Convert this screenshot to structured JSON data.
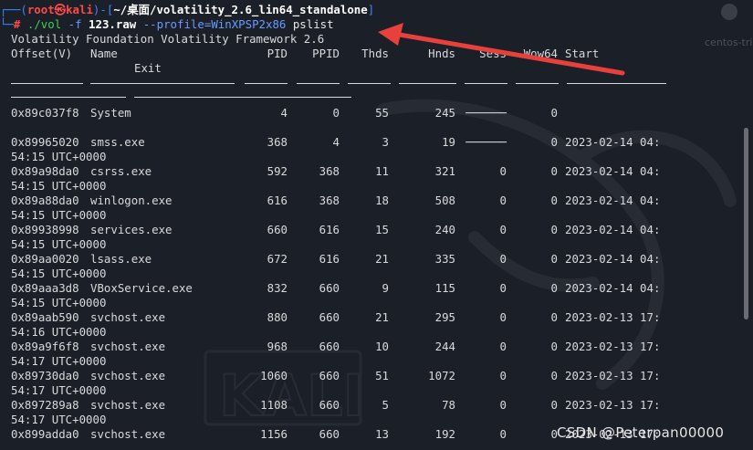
{
  "prompt": {
    "user": "root㉿kali",
    "path": "~/桌面/volatility_2.6_lin64_standalone",
    "hash": "#",
    "cmd": "./vol",
    "file_flag": "-f",
    "file": "123.raw",
    "profile_flag": "--profile=WinXPSP2x86",
    "plugin": "pslist"
  },
  "banner": "Volatility Foundation Volatility Framework 2.6",
  "headers": [
    "Offset(V)",
    "Name",
    "PID",
    "PPID",
    "Thds",
    "Hnds",
    "Sess",
    "Wow64",
    "Start",
    "Exit"
  ],
  "rows": [
    {
      "offset": "0x89c037f8",
      "name": "System",
      "pid": "4",
      "ppid": "0",
      "thds": "55",
      "hnds": "245",
      "sess": "──────",
      "wow": "0",
      "start": "",
      "cont": ""
    },
    {
      "offset": "0x89965020",
      "name": "smss.exe",
      "pid": "368",
      "ppid": "4",
      "thds": "3",
      "hnds": "19",
      "sess": "──────",
      "wow": "0",
      "start": "2023-02-14 04:",
      "cont": "54:15 UTC+0000"
    },
    {
      "offset": "0x89a98da0",
      "name": "csrss.exe",
      "pid": "592",
      "ppid": "368",
      "thds": "11",
      "hnds": "321",
      "sess": "0",
      "wow": "0",
      "start": "2023-02-14 04:",
      "cont": "54:15 UTC+0000"
    },
    {
      "offset": "0x89a88da0",
      "name": "winlogon.exe",
      "pid": "616",
      "ppid": "368",
      "thds": "18",
      "hnds": "508",
      "sess": "0",
      "wow": "0",
      "start": "2023-02-14 04:",
      "cont": "54:15 UTC+0000"
    },
    {
      "offset": "0x89938998",
      "name": "services.exe",
      "pid": "660",
      "ppid": "616",
      "thds": "15",
      "hnds": "240",
      "sess": "0",
      "wow": "0",
      "start": "2023-02-14 04:",
      "cont": "54:15 UTC+0000"
    },
    {
      "offset": "0x89aa0020",
      "name": "lsass.exe",
      "pid": "672",
      "ppid": "616",
      "thds": "21",
      "hnds": "335",
      "sess": "0",
      "wow": "0",
      "start": "2023-02-14 04:",
      "cont": "54:15 UTC+0000"
    },
    {
      "offset": "0x89aaa3d8",
      "name": "VBoxService.exe",
      "pid": "832",
      "ppid": "660",
      "thds": "9",
      "hnds": "115",
      "sess": "0",
      "wow": "0",
      "start": "2023-02-14 04:",
      "cont": "54:15 UTC+0000"
    },
    {
      "offset": "0x89aab590",
      "name": "svchost.exe",
      "pid": "880",
      "ppid": "660",
      "thds": "21",
      "hnds": "295",
      "sess": "0",
      "wow": "0",
      "start": "2023-02-13 17:",
      "cont": "54:16 UTC+0000"
    },
    {
      "offset": "0x89a9f6f8",
      "name": "svchost.exe",
      "pid": "968",
      "ppid": "660",
      "thds": "10",
      "hnds": "244",
      "sess": "0",
      "wow": "0",
      "start": "2023-02-13 17:",
      "cont": "54:17 UTC+0000"
    },
    {
      "offset": "0x89730da0",
      "name": "svchost.exe",
      "pid": "1060",
      "ppid": "660",
      "thds": "51",
      "hnds": "1072",
      "sess": "0",
      "wow": "0",
      "start": "2023-02-13 17:",
      "cont": "54:17 UTC+0000"
    },
    {
      "offset": "0x897289a8",
      "name": "svchost.exe",
      "pid": "1108",
      "ppid": "660",
      "thds": "5",
      "hnds": "78",
      "sess": "0",
      "wow": "0",
      "start": "2023-02-13 17:",
      "cont": "54:17 UTC+0000"
    },
    {
      "offset": "0x899adda0",
      "name": "svchost.exe",
      "pid": "1156",
      "ppid": "660",
      "thds": "13",
      "hnds": "192",
      "sess": "0",
      "wow": "0",
      "start": "2023-02-13 17:",
      "cont": ""
    }
  ],
  "watermark": "CSDN @Peterpan00000",
  "corner_text": "centos-tri",
  "colors": {
    "background": "#1b1f27",
    "prompt_blue": "#3a86ff",
    "prompt_red": "#ff4a4a",
    "arrow": "#e8413c"
  }
}
